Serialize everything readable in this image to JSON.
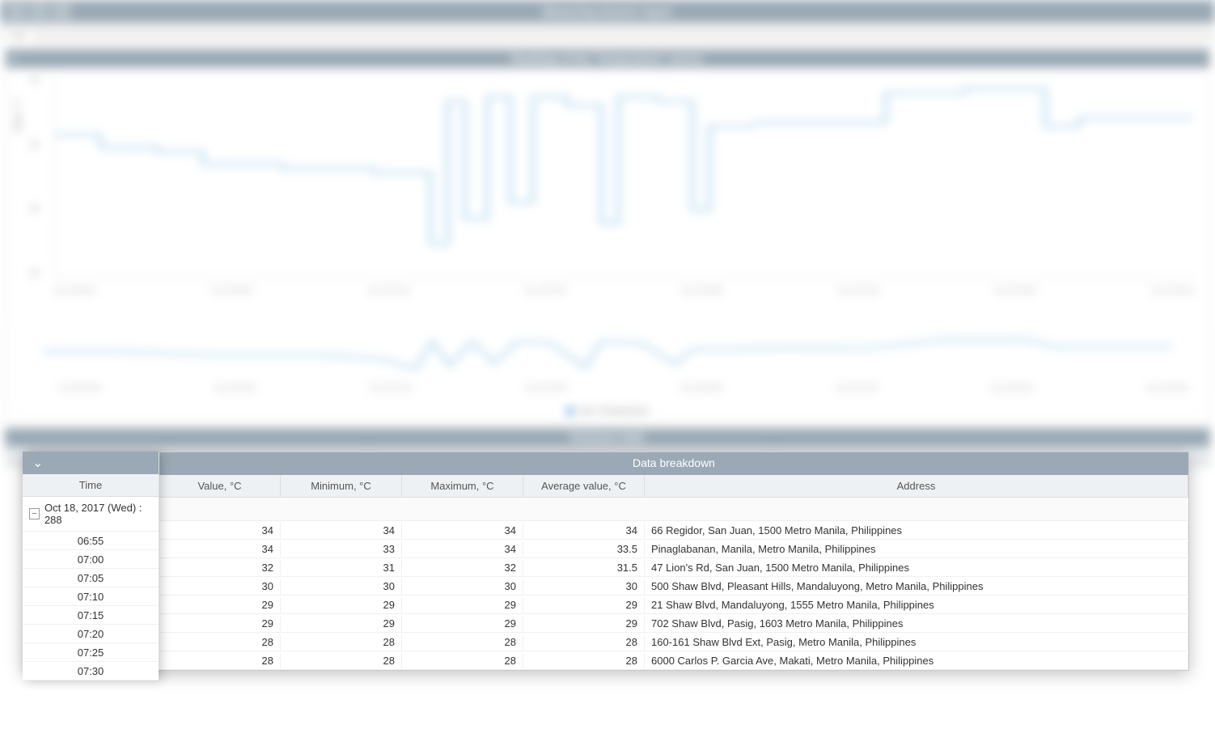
{
  "header": {
    "title": "Measuring sensors report"
  },
  "tabs": {
    "active": "test"
  },
  "chart": {
    "panel_title": "Readings of the \"Temperature\" sensor",
    "ylabel": "Value, °C",
    "xlabel": "Time",
    "legend_label": "test: Temperature",
    "yticks": [
      "40",
      "35",
      "30",
      "25"
    ],
    "xticks": [
      "Oct 18 06:00",
      "Oct 18 09:00",
      "Oct 18 12:00",
      "Oct 18 15:00",
      "Oct 18 18:00",
      "Oct 18 21:00",
      "Oct 19 00:00",
      "Oct 19 03:00"
    ]
  },
  "chart_data": {
    "type": "line",
    "title": "Readings of the \"Temperature\" sensor",
    "ylabel": "Value, °C",
    "xlabel": "Time",
    "ylim": [
      24,
      41
    ],
    "series": [
      {
        "name": "test: Temperature",
        "x": [
          "Oct 18 06:00",
          "Oct 18 07:00",
          "Oct 18 08:00",
          "Oct 18 09:00",
          "Oct 18 10:00",
          "Oct 18 11:00",
          "Oct 18 11:30",
          "Oct 18 12:00",
          "Oct 18 12:30",
          "Oct 18 13:00",
          "Oct 18 13:30",
          "Oct 18 14:00",
          "Oct 18 15:00",
          "Oct 18 15:30",
          "Oct 18 16:00",
          "Oct 18 17:00",
          "Oct 18 17:30",
          "Oct 18 18:00",
          "Oct 18 19:00",
          "Oct 18 20:00",
          "Oct 18 21:00",
          "Oct 18 22:00",
          "Oct 18 23:00",
          "Oct 19 00:00",
          "Oct 19 01:00",
          "Oct 19 02:00",
          "Oct 19 03:00",
          "Oct 19 04:00",
          "Oct 19 05:00"
        ],
        "values": [
          34,
          33,
          32,
          30,
          30,
          30,
          25,
          38,
          29,
          38,
          31,
          38,
          37,
          28,
          38,
          38,
          30,
          36,
          36,
          36,
          37,
          40,
          40,
          40,
          40,
          40,
          37,
          38,
          37
        ]
      }
    ]
  },
  "summary_table": {
    "title": "Summary table"
  },
  "breakdown": {
    "title": "Data breakdown",
    "columns": {
      "time": "Time",
      "value": "Value, °C",
      "min": "Minimum, °C",
      "max": "Maximum, °C",
      "avg": "Average value, °C",
      "addr": "Address"
    },
    "date_group": "Oct 18, 2017 (Wed) : 288",
    "rows": [
      {
        "time": "06:55",
        "value": "34",
        "min": "34",
        "max": "34",
        "avg": "34",
        "addr": "66 Regidor, San Juan, 1500 Metro Manila, Philippines"
      },
      {
        "time": "07:00",
        "value": "34",
        "min": "33",
        "max": "34",
        "avg": "33.5",
        "addr": "Pinaglabanan, Manila, Metro Manila, Philippines"
      },
      {
        "time": "07:05",
        "value": "32",
        "min": "31",
        "max": "32",
        "avg": "31.5",
        "addr": "47 Lion's Rd, San Juan, 1500 Metro Manila, Philippines"
      },
      {
        "time": "07:10",
        "value": "30",
        "min": "30",
        "max": "30",
        "avg": "30",
        "addr": "500 Shaw Blvd, Pleasant Hills, Mandaluyong, Metro Manila, Philippines"
      },
      {
        "time": "07:15",
        "value": "29",
        "min": "29",
        "max": "29",
        "avg": "29",
        "addr": "21 Shaw Blvd, Mandaluyong, 1555 Metro Manila, Philippines"
      },
      {
        "time": "07:20",
        "value": "29",
        "min": "29",
        "max": "29",
        "avg": "29",
        "addr": "702 Shaw Blvd, Pasig, 1603 Metro Manila, Philippines"
      },
      {
        "time": "07:25",
        "value": "28",
        "min": "28",
        "max": "28",
        "avg": "28",
        "addr": "160-161 Shaw Blvd Ext, Pasig, Metro Manila, Philippines"
      },
      {
        "time": "07:30",
        "value": "28",
        "min": "28",
        "max": "28",
        "avg": "28",
        "addr": "6000 Carlos P. Garcia Ave, Makati, Metro Manila, Philippines"
      }
    ]
  }
}
